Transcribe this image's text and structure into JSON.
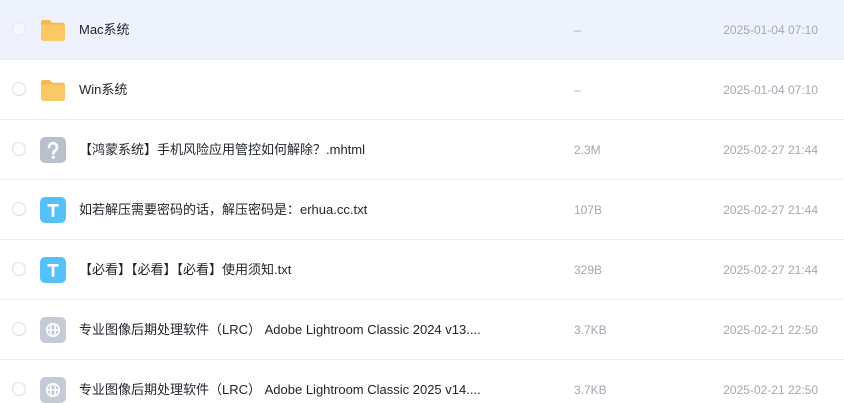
{
  "files": [
    {
      "name": "Mac系统",
      "size": "–",
      "modified": "2025-01-04 07:10",
      "icon": "folder-icon",
      "selected": true
    },
    {
      "name": "Win系统",
      "size": "–",
      "modified": "2025-01-04 07:10",
      "icon": "folder-icon",
      "selected": false
    },
    {
      "name": "【鸿蒙系统】手机风险应用管控如何解除？.mhtml",
      "size": "2.3M",
      "modified": "2025-02-27 21:44",
      "icon": "unknown-file-icon",
      "selected": false
    },
    {
      "name": "如若解压需要密码的话，解压密码是：erhua.cc.txt",
      "size": "107B",
      "modified": "2025-02-27 21:44",
      "icon": "text-file-icon",
      "selected": false
    },
    {
      "name": "【必看】【必看】【必看】使用须知.txt",
      "size": "329B",
      "modified": "2025-02-27 21:44",
      "icon": "text-file-icon",
      "selected": false
    },
    {
      "name": "专业图像后期处理软件（LRC） Adobe Lightroom Classic 2024 v13....",
      "size": "3.7KB",
      "modified": "2025-02-21 22:50",
      "icon": "web-file-icon",
      "selected": false
    },
    {
      "name": "专业图像后期处理软件（LRC） Adobe Lightroom Classic 2025 v14....",
      "size": "3.7KB",
      "modified": "2025-02-21 22:50",
      "icon": "web-file-icon",
      "selected": false
    }
  ],
  "colors": {
    "selected_row": "#eef2fd",
    "folder": "#fcc866",
    "text_file": "#56c1f8",
    "unknown_file": "#b9bfcb",
    "web_file": "#c4cad6"
  }
}
